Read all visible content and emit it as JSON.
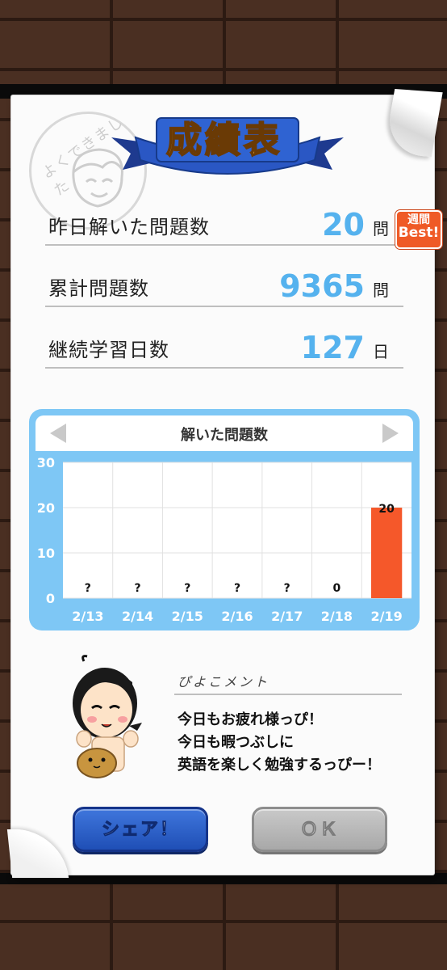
{
  "scorecard": {
    "title": "成績表",
    "stamp_text": "よくできました"
  },
  "stats": [
    {
      "label": "昨日解いた問題数",
      "value": "20",
      "unit": "問"
    },
    {
      "label": "累計問題数",
      "value": "9365",
      "unit": "問"
    },
    {
      "label": "継続学習日数",
      "value": "127",
      "unit": "日"
    }
  ],
  "badge": {
    "line1": "週間",
    "line2": "Best!"
  },
  "chart": {
    "title": "解いた問題数"
  },
  "chart_data": {
    "type": "bar",
    "title": "解いた問題数",
    "categories": [
      "2/13",
      "2/14",
      "2/15",
      "2/16",
      "2/17",
      "2/18",
      "2/19"
    ],
    "values": [
      null,
      null,
      null,
      null,
      null,
      0,
      20
    ],
    "data_labels": [
      "?",
      "?",
      "?",
      "?",
      "?",
      "0",
      "20"
    ],
    "yticks": [
      0,
      10,
      20,
      30
    ],
    "ylim": [
      0,
      30
    ],
    "bar_color": "#f5582a",
    "grid": true
  },
  "comment": {
    "label": "ぴよこメント",
    "lines": [
      "今日もお疲れ様っぴ！",
      "今日も暇つぶしに",
      "英語を楽しく勉強するっぴー！"
    ]
  },
  "buttons": {
    "share": "シェア！",
    "ok": "ＯＫ"
  },
  "colors": {
    "accent_blue": "#55b2ee",
    "bar": "#f5582a",
    "panel": "#7ec7f5"
  }
}
